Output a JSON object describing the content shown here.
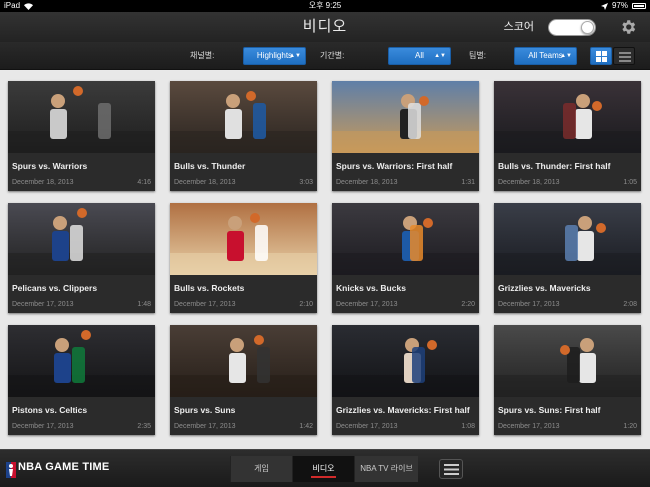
{
  "status_bar": {
    "device": "iPad",
    "time": "오후 9:25",
    "battery": "97%"
  },
  "header": {
    "title": "비디오",
    "score_label": "스코어"
  },
  "filters": {
    "channel_label": "채널별:",
    "channel_value": "Highlights",
    "period_label": "기간별:",
    "period_value": "All",
    "team_label": "팀별:",
    "team_value": "All Teams"
  },
  "videos": [
    {
      "title": "Spurs vs. Warriors",
      "date": "December 18, 2013",
      "duration": "4:16"
    },
    {
      "title": "Bulls vs. Thunder",
      "date": "December 18, 2013",
      "duration": "3:03"
    },
    {
      "title": "Spurs vs. Warriors: First half",
      "date": "December 18, 2013",
      "duration": "1:31"
    },
    {
      "title": "Bulls vs. Thunder: First half",
      "date": "December 18, 2013",
      "duration": "1:05"
    },
    {
      "title": "Pelicans vs. Clippers",
      "date": "December 17, 2013",
      "duration": "1:48"
    },
    {
      "title": "Bulls vs. Rockets",
      "date": "December 17, 2013",
      "duration": "2:10"
    },
    {
      "title": "Knicks vs. Bucks",
      "date": "December 17, 2013",
      "duration": "2:20"
    },
    {
      "title": "Grizzlies vs. Mavericks",
      "date": "December 17, 2013",
      "duration": "2:08"
    },
    {
      "title": "Pistons vs. Celtics",
      "date": "December 17, 2013",
      "duration": "2:35"
    },
    {
      "title": "Spurs vs. Suns",
      "date": "December 17, 2013",
      "duration": "1:42"
    },
    {
      "title": "Grizzlies vs. Mavericks: First half",
      "date": "December 17, 2013",
      "duration": "1:08"
    },
    {
      "title": "Spurs vs. Suns: First half",
      "date": "December 17, 2013",
      "duration": "1:20"
    }
  ],
  "bottom": {
    "brand": "NBA GAME TIME",
    "tabs": [
      "게임",
      "비디오",
      "NBA TV 라이브"
    ]
  },
  "colors": {
    "accent_blue": "#2a7fd4",
    "active_underline": "#d12a2a",
    "header_bg": "#2b2b2b"
  }
}
